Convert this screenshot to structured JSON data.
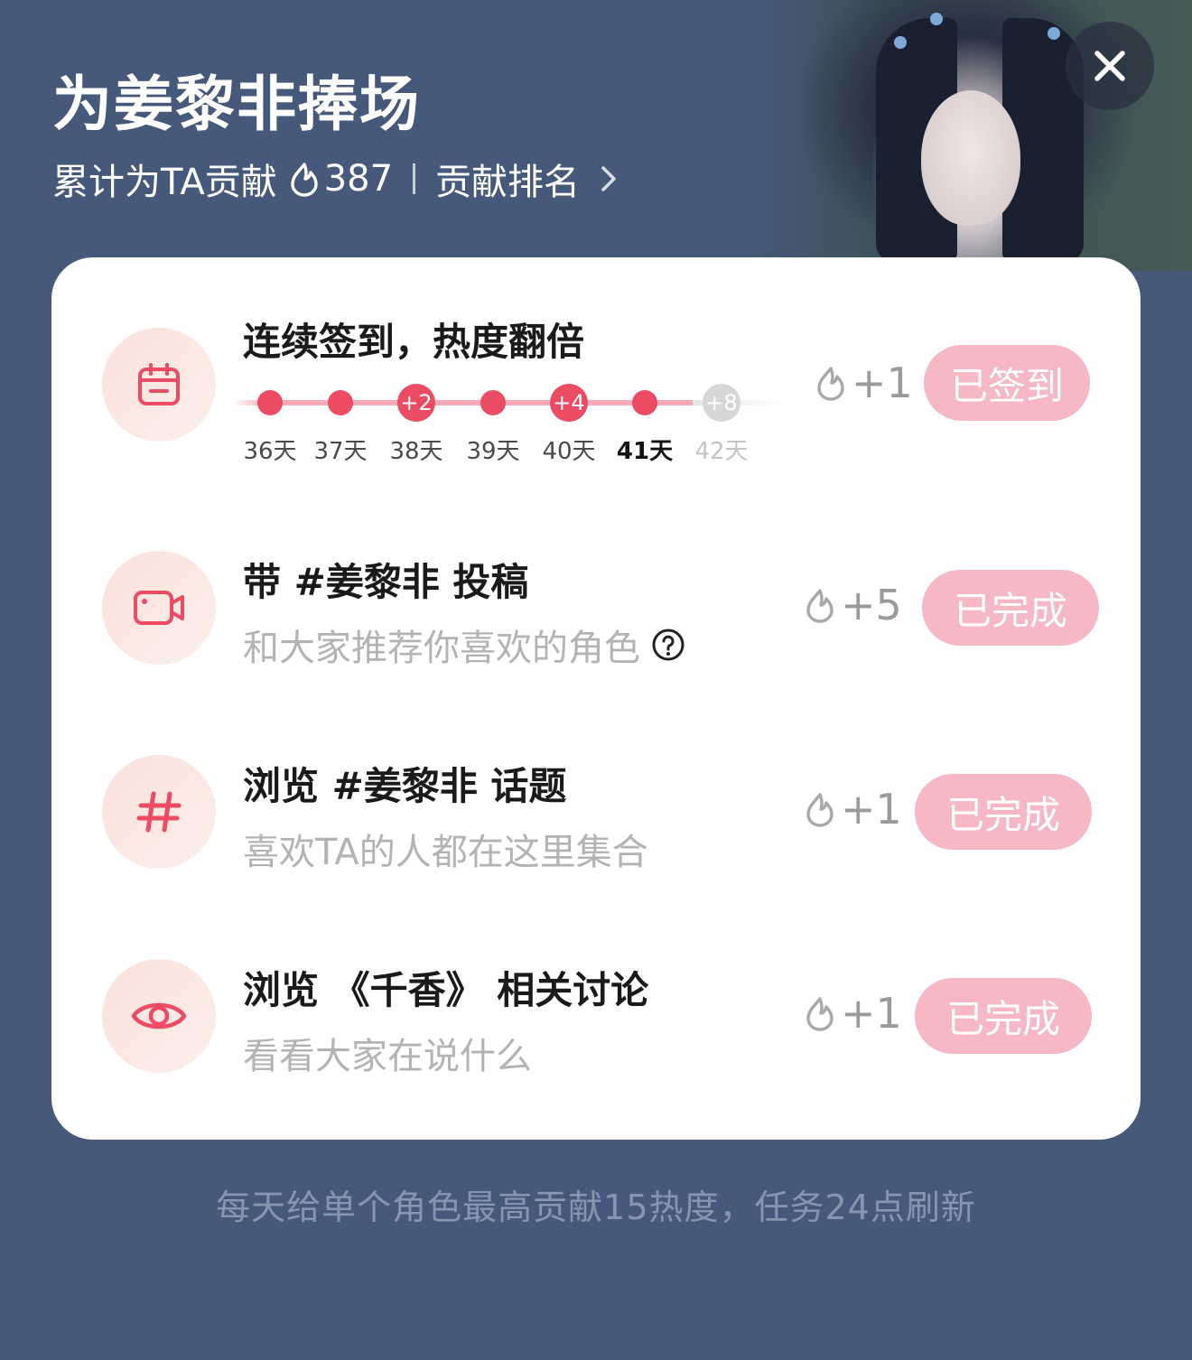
{
  "header": {
    "title": "为姜黎非捧场",
    "contribution_prefix": "累计为TA贡献",
    "contribution_value": "387",
    "rank_link": "贡献排名"
  },
  "tasks": [
    {
      "title": "连续签到，热度翻倍",
      "reward": "+1",
      "button": "已签到",
      "icon": "calendar-icon",
      "streak": [
        {
          "day": "36天",
          "bonus": ""
        },
        {
          "day": "37天",
          "bonus": ""
        },
        {
          "day": "38天",
          "bonus": "+2"
        },
        {
          "day": "39天",
          "bonus": ""
        },
        {
          "day": "40天",
          "bonus": "+4"
        },
        {
          "day": "41天",
          "bonus": ""
        },
        {
          "day": "42天",
          "bonus": "+8"
        }
      ]
    },
    {
      "title": "带 #姜黎非 投稿",
      "desc": "和大家推荐你喜欢的角色",
      "reward": "+5",
      "button": "已完成",
      "icon": "video-camera-icon"
    },
    {
      "title": "浏览 #姜黎非 话题",
      "desc": "喜欢TA的人都在这里集合",
      "reward": "+1",
      "button": "已完成",
      "icon": "hashtag-icon"
    },
    {
      "title": "浏览 《千香》 相关讨论",
      "desc": "看看大家在说什么",
      "reward": "+1",
      "button": "已完成",
      "icon": "eye-icon"
    }
  ],
  "footer": "每天给单个角色最高贡献15热度，任务24点刷新",
  "colors": {
    "background": "#46597a",
    "accent": "#ec4b64",
    "button": "#f5b8c4",
    "icon_bg": "#fbe6e1"
  }
}
